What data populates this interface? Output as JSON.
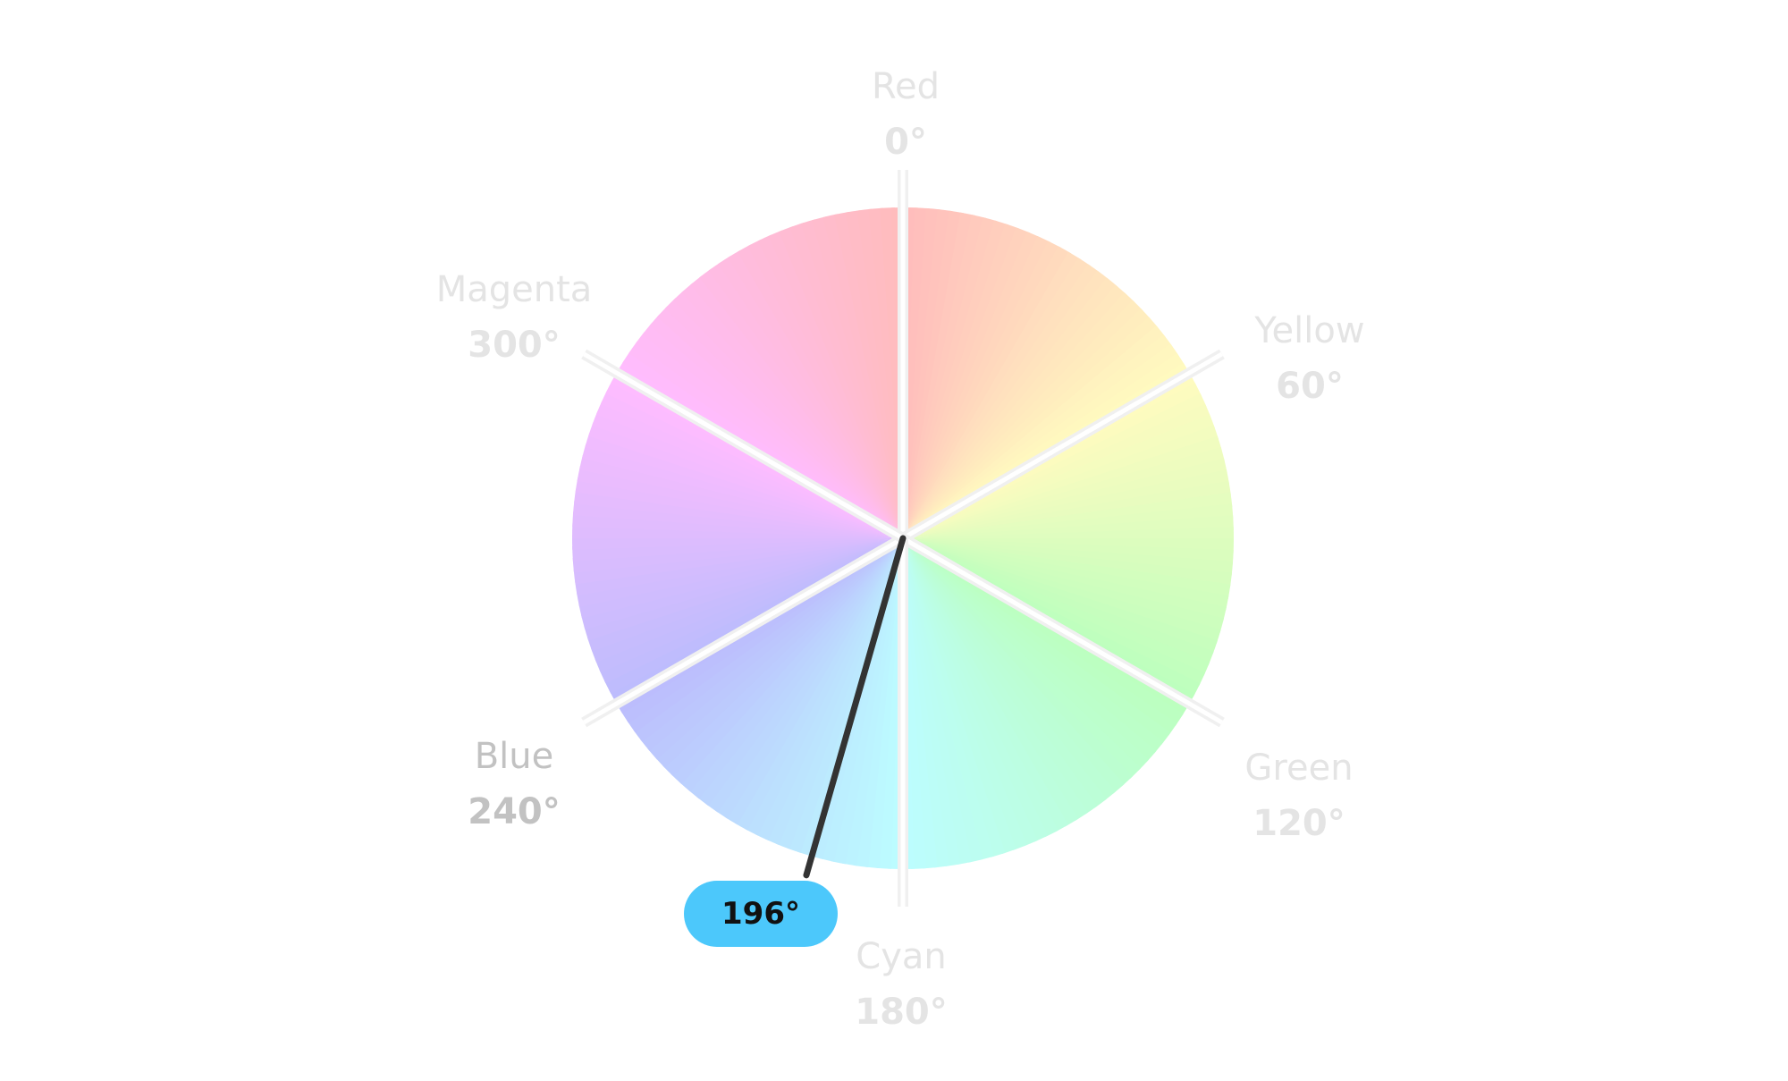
{
  "hue_wheel": {
    "labels": [
      {
        "name": "Red",
        "degrees": "0°",
        "hue": 0
      },
      {
        "name": "Yellow",
        "degrees": "60°",
        "hue": 60
      },
      {
        "name": "Green",
        "degrees": "120°",
        "hue": 120
      },
      {
        "name": "Cyan",
        "degrees": "180°",
        "hue": 180
      },
      {
        "name": "Blue",
        "degrees": "240°",
        "hue": 240
      },
      {
        "name": "Magenta",
        "degrees": "300°",
        "hue": 300
      }
    ],
    "highlighted_label": "Blue",
    "pointer": {
      "value": 196,
      "label": "196°",
      "badge_color": "#4cc8fb",
      "line_color": "#333333"
    },
    "colors": {
      "red": "#ffbcbc",
      "yellow": "#fffbbf",
      "green": "#bcffbe",
      "cyan": "#bcfdff",
      "blue": "#bcbcfd",
      "magenta": "#ffbcff",
      "separator": "#f0f0f0",
      "label": "#e4e4e4",
      "highlighted_label": "#c2c2c2"
    }
  }
}
